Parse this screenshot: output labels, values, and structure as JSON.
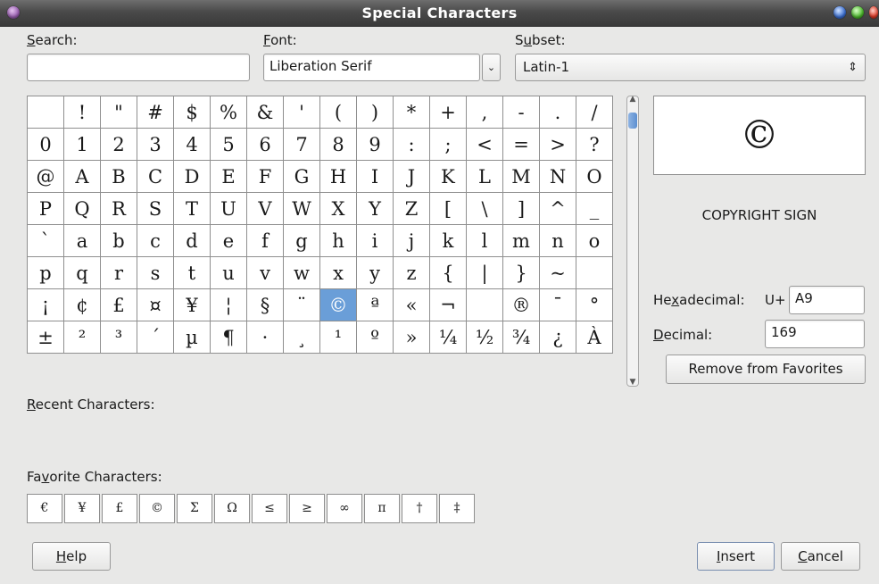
{
  "window": {
    "title": "Special Characters"
  },
  "search": {
    "label": "Search:",
    "mnemonic": "S",
    "rest": "earch:",
    "value": ""
  },
  "font": {
    "label": "Font:",
    "mnemonic": "F",
    "rest": "ont:",
    "value": "Liberation Serif"
  },
  "subset": {
    "label": "Subset:",
    "pre": "S",
    "mnemonic": "u",
    "rest": "bset:",
    "value": "Latin-1"
  },
  "grid": {
    "rows": [
      [
        " ",
        "!",
        "\"",
        "#",
        "$",
        "%",
        "&",
        "'",
        "(",
        ")",
        "*",
        "+",
        ",",
        "-",
        ".",
        "/"
      ],
      [
        "0",
        "1",
        "2",
        "3",
        "4",
        "5",
        "6",
        "7",
        "8",
        "9",
        ":",
        ";",
        "<",
        "=",
        ">",
        "?"
      ],
      [
        "@",
        "A",
        "B",
        "C",
        "D",
        "E",
        "F",
        "G",
        "H",
        "I",
        "J",
        "K",
        "L",
        "M",
        "N",
        "O"
      ],
      [
        "P",
        "Q",
        "R",
        "S",
        "T",
        "U",
        "V",
        "W",
        "X",
        "Y",
        "Z",
        "[",
        "\\",
        "]",
        "^",
        "_"
      ],
      [
        "`",
        "a",
        "b",
        "c",
        "d",
        "e",
        "f",
        "g",
        "h",
        "i",
        "j",
        "k",
        "l",
        "m",
        "n",
        "o"
      ],
      [
        "p",
        "q",
        "r",
        "s",
        "t",
        "u",
        "v",
        "w",
        "x",
        "y",
        "z",
        "{",
        "|",
        "}",
        "~",
        ""
      ],
      [
        "¡",
        "¢",
        "£",
        "¤",
        "¥",
        "¦",
        "§",
        "¨",
        "©",
        "ª",
        "«",
        "¬",
        "",
        "®",
        "¯",
        "°"
      ],
      [
        "±",
        "²",
        "³",
        "´",
        "µ",
        "¶",
        "·",
        "¸",
        "¹",
        "º",
        "»",
        "¼",
        "½",
        "¾",
        "¿",
        "À"
      ]
    ],
    "selected": "©"
  },
  "preview": {
    "char": "©",
    "name": "COPYRIGHT SIGN"
  },
  "hex": {
    "label": "Hexadecimal:",
    "pre": "He",
    "mnemonic": "x",
    "rest": "adecimal:",
    "prefix": "U+",
    "value": "A9"
  },
  "decimal": {
    "label": "Decimal:",
    "mnemonic": "D",
    "rest": "ecimal:",
    "value": "169"
  },
  "favorites_button": "Remove from Favorites",
  "recent": {
    "label": "Recent Characters:",
    "mnemonic": "R",
    "rest": "ecent Characters:"
  },
  "favorite": {
    "label": "Favorite Characters:",
    "pre": "Fa",
    "mnemonic": "v",
    "rest": "orite Characters:",
    "items": [
      "€",
      "¥",
      "£",
      "©",
      "Σ",
      "Ω",
      "≤",
      "≥",
      "∞",
      "π",
      "†",
      "‡"
    ]
  },
  "buttons": {
    "help": {
      "mnemonic": "H",
      "rest": "elp"
    },
    "insert": {
      "mnemonic": "I",
      "rest": "nsert"
    },
    "cancel": {
      "mnemonic": "C",
      "rest": "ancel"
    }
  },
  "colors": {
    "selection": "#6a9ed8",
    "titlebar": "#4a4a4a"
  }
}
